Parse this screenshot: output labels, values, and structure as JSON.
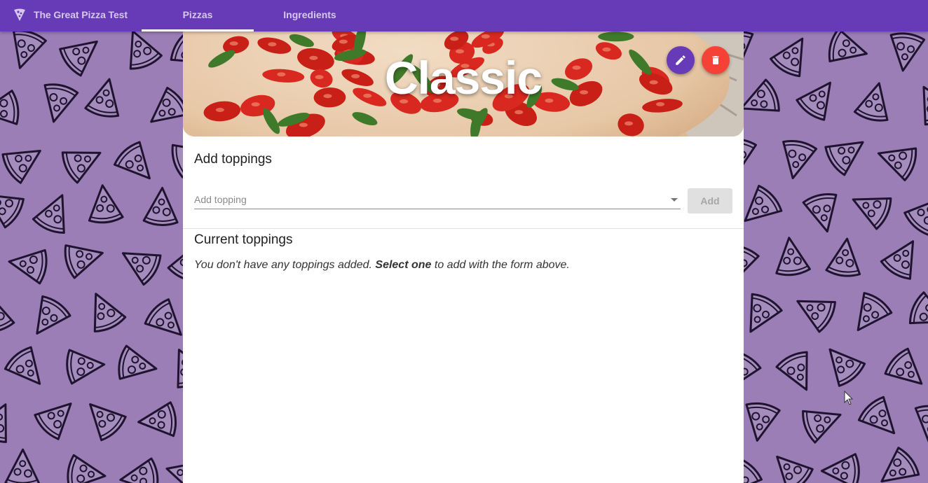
{
  "app": {
    "title": "The Great Pizza Test"
  },
  "nav": {
    "tabs": [
      {
        "label": "Pizzas",
        "active": true
      },
      {
        "label": "Ingredients",
        "active": false
      }
    ]
  },
  "pizza": {
    "name": "Classic"
  },
  "actions": {
    "edit_icon": "pencil-icon",
    "delete_icon": "trash-icon"
  },
  "add_toppings": {
    "heading": "Add toppings",
    "select_placeholder": "Add topping",
    "add_label": "Add"
  },
  "current_toppings": {
    "heading": "Current toppings",
    "empty_prefix": "You don't have any toppings added.",
    "empty_emphasis": "Select one",
    "empty_suffix": "to add with the form above."
  },
  "colors": {
    "primary": "#673ab7",
    "danger": "#f44336",
    "background": "#9a7eb5"
  }
}
